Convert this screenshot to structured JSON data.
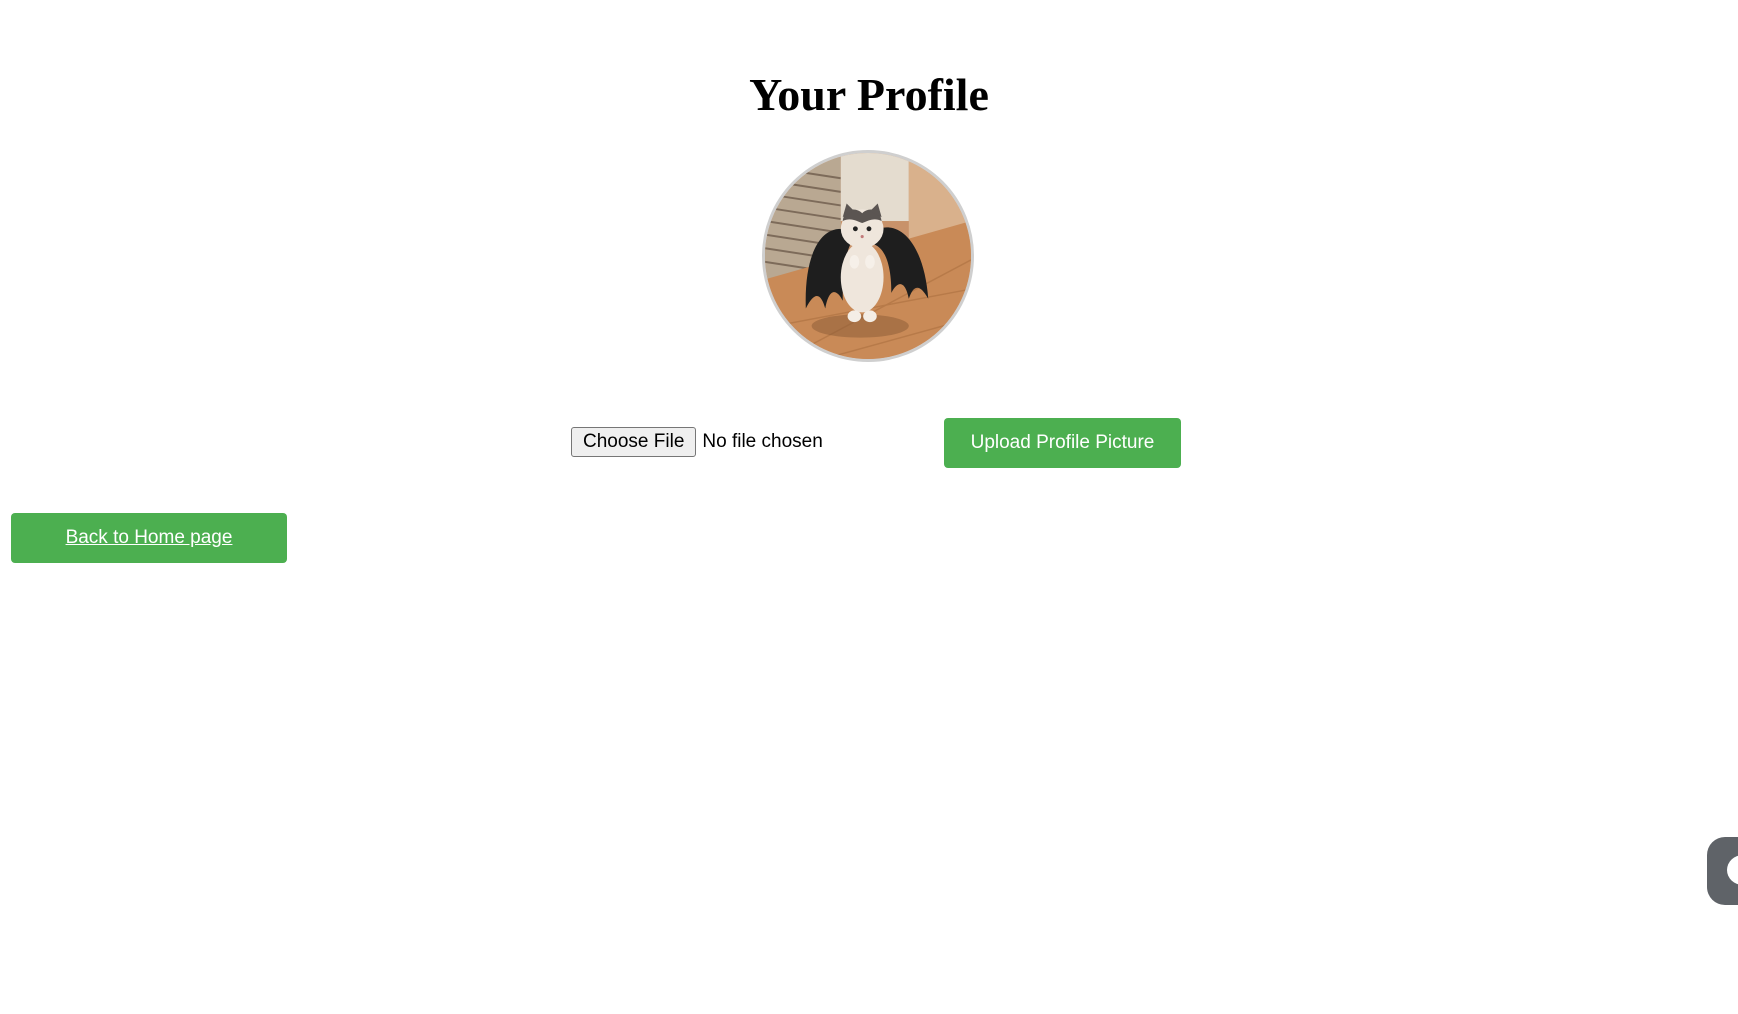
{
  "page": {
    "title": "Your Profile"
  },
  "avatar": {
    "alt": "Profile picture of a kitten wearing bat wings"
  },
  "upload_form": {
    "choose_file_label": "Choose File",
    "file_status": "No file chosen",
    "upload_label": "Upload Profile Picture"
  },
  "navigation": {
    "back_home_label": "Back to Home page"
  },
  "colors": {
    "accent": "#4caf50",
    "chat_widget": "#5f6368"
  },
  "icons": {
    "chat_widget": "chat-icon"
  }
}
